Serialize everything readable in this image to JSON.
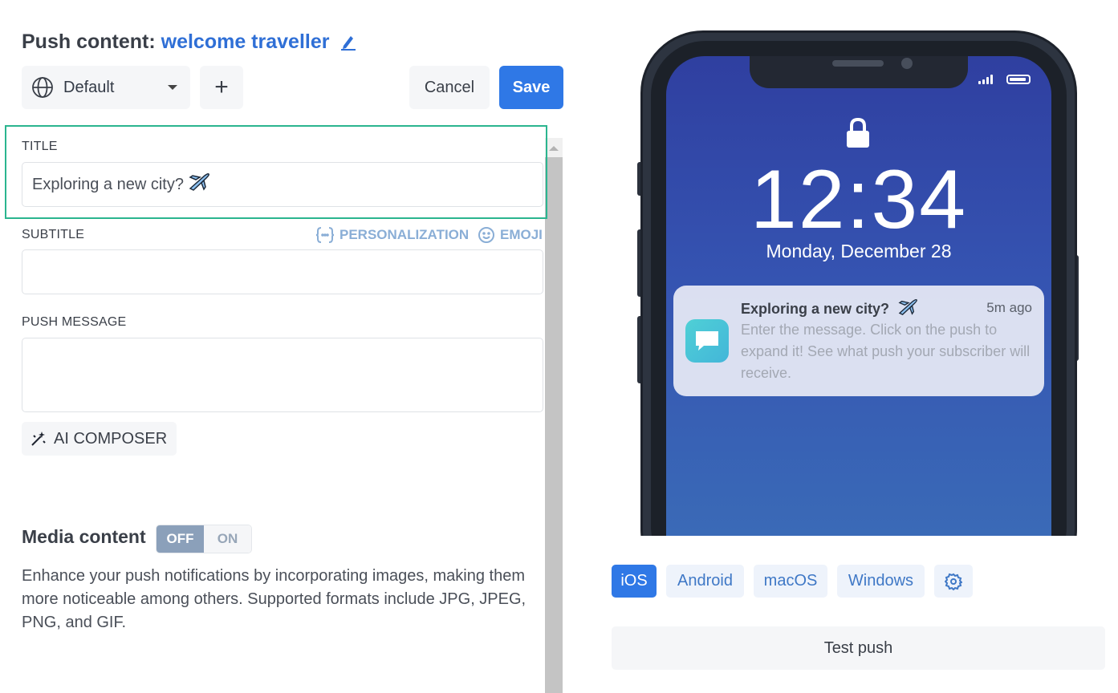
{
  "header": {
    "prefix": "Push content:",
    "campaign_name": "welcome traveller"
  },
  "toolbar": {
    "language": "Default",
    "add_label": "+",
    "cancel_label": "Cancel",
    "save_label": "Save"
  },
  "form": {
    "title": {
      "label": "TITLE",
      "value": "Exploring a new city?"
    },
    "subtitle": {
      "label": "SUBTITLE",
      "value": ""
    },
    "personalization_label": "PERSONALIZATION",
    "emoji_label": "EMOJI",
    "push_message": {
      "label": "PUSH MESSAGE",
      "value": ""
    },
    "ai_composer_label": "AI COMPOSER"
  },
  "media": {
    "title": "Media content",
    "toggle_off": "OFF",
    "toggle_on": "ON",
    "toggle_state": "OFF",
    "description": "Enhance your push notifications by incorporating images, making them more noticeable among others. Supported formats include JPG, JPEG, PNG, and GIF."
  },
  "preview": {
    "time": "12:34",
    "date": "Monday, December 28",
    "notification": {
      "title": "Exploring a new city?",
      "time_ago": "5m ago",
      "body": "Enter the message. Click on the push to expand it! See what push your subscriber will receive."
    }
  },
  "platforms": {
    "tabs": [
      "iOS",
      "Android",
      "macOS",
      "Windows"
    ],
    "active": "iOS"
  },
  "test_push_label": "Test push",
  "colors": {
    "accent": "#2f78e6",
    "campaign_link": "#2f6fd6",
    "highlight_border": "#2bb58f"
  }
}
